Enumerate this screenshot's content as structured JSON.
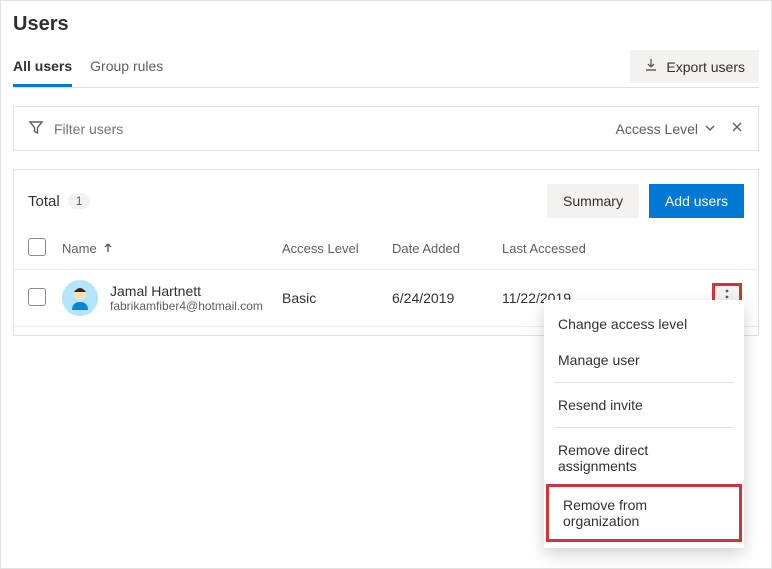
{
  "page_title": "Users",
  "tabs": {
    "all_users": "All users",
    "group_rules": "Group rules"
  },
  "export_label": "Export users",
  "filter": {
    "placeholder": "Filter users",
    "dropdown_label": "Access Level"
  },
  "panel": {
    "total_label": "Total",
    "total_count": "1",
    "summary_btn": "Summary",
    "add_users_btn": "Add users"
  },
  "columns": {
    "name": "Name",
    "access": "Access Level",
    "date_added": "Date Added",
    "last_accessed": "Last Accessed"
  },
  "row": {
    "name": "Jamal Hartnett",
    "email": "fabrikamfiber4@hotmail.com",
    "access": "Basic",
    "date_added": "6/24/2019",
    "last_accessed": "11/22/2019"
  },
  "menu": {
    "change_access": "Change access level",
    "manage_user": "Manage user",
    "resend_invite": "Resend invite",
    "remove_direct": "Remove direct assignments",
    "remove_org": "Remove from organization"
  }
}
